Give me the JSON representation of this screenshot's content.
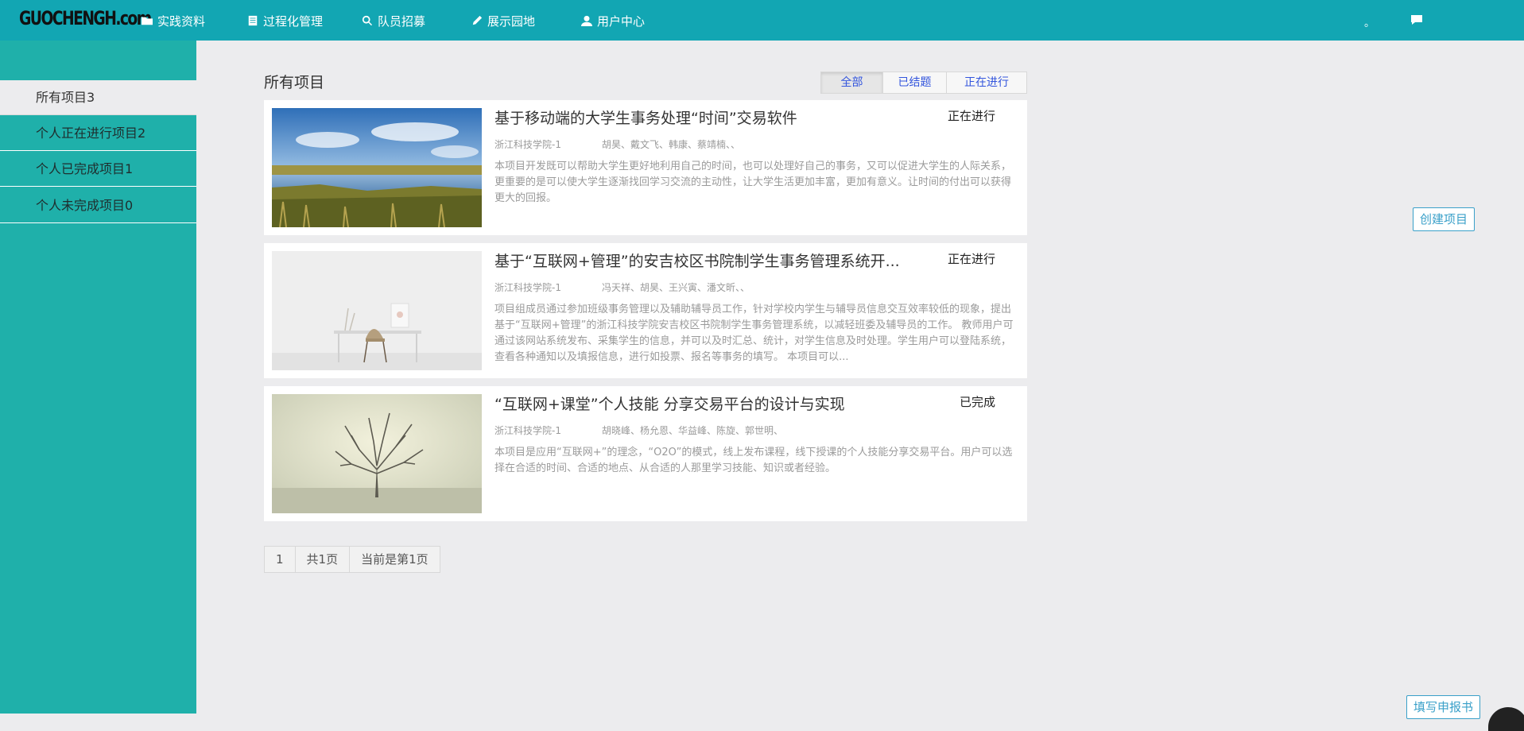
{
  "nav": {
    "logo": "GUOCHENGH.com",
    "items": [
      {
        "label": "实践资料",
        "icon": "folder-icon"
      },
      {
        "label": "过程化管理",
        "icon": "list-icon"
      },
      {
        "label": "队员招募",
        "icon": "search-icon"
      },
      {
        "label": "展示园地",
        "icon": "pencil-icon"
      },
      {
        "label": "用户中心",
        "icon": "user-icon"
      }
    ],
    "dot": "。",
    "chat_icon": "chat-icon"
  },
  "sidebar": {
    "items": [
      {
        "label": "所有项目3",
        "active": true
      },
      {
        "label": "个人正在进行项目2",
        "active": false
      },
      {
        "label": "个人已完成项目1",
        "active": false
      },
      {
        "label": "个人未完成项目0",
        "active": false
      }
    ]
  },
  "main": {
    "title": "所有项目",
    "filters": [
      {
        "label": "全部",
        "active": true
      },
      {
        "label": "已结题",
        "active": false
      },
      {
        "label": "正在进行",
        "active": false
      }
    ]
  },
  "projects": [
    {
      "title": "基于移动端的大学生事务处理“时间”交易软件",
      "status": "正在进行",
      "school": "浙江科技学院-1",
      "members": "胡昊、戴文飞、韩康、蔡靖楠、、",
      "description": "本项目开发既可以帮助大学生更好地利用自己的时间，也可以处理好自己的事务，又可以促进大学生的人际关系，更重要的是可以使大学生逐渐找回学习交流的主动性，让大学生活更加丰富，更加有意义。让时间的付出可以获得更大的回报。",
      "image": "lake-landscape"
    },
    {
      "title": "基于“互联网+管理”的安吉校区书院制学生事务管理系统开...",
      "status": "正在进行",
      "school": "浙江科技学院-1",
      "members": "冯天祥、胡昊、王兴寅、潘文昕、、",
      "description": "项目组成员通过参加班级事务管理以及辅助辅导员工作，针对学校内学生与辅导员信息交互效率较低的现象，提出基于“互联网+管理”的浙江科技学院安吉校区书院制学生事务管理系统，以减轻班委及辅导员的工作。 教师用户可通过该网站系统发布、采集学生的信息，并可以及时汇总、统计，对学生信息及时处理。学生用户可以登陆系统，查看各种通知以及填报信息，进行如投票、报名等事务的填写。 本项目可以...",
      "image": "white-desk-chair"
    },
    {
      "title": "“互联网+课堂”个人技能 分享交易平台的设计与实现",
      "status": "已完成",
      "school": "浙江科技学院-1",
      "members": "胡晓峰、杨允恩、华益峰、陈旋、郭世明、",
      "description": "本项目是应用“互联网+”的理念，“O2O”的模式，线上发布课程，线下授课的个人技能分享交易平台。用户可以选择在合适的时间、合适的地点、从合适的人那里学习技能、知识或者经验。",
      "image": "foggy-tree"
    }
  ],
  "pager": {
    "page": "1",
    "total": "共1页",
    "current": "当前是第1页"
  },
  "buttons": {
    "create": "创建项目",
    "report": "填写申报书"
  },
  "colors": {
    "nav_bg": "#12a6b3",
    "sidebar_bg": "#1fb0aa",
    "page_bg": "#ececee",
    "link_blue": "#3355dd",
    "button_border": "#3aa0c9"
  }
}
